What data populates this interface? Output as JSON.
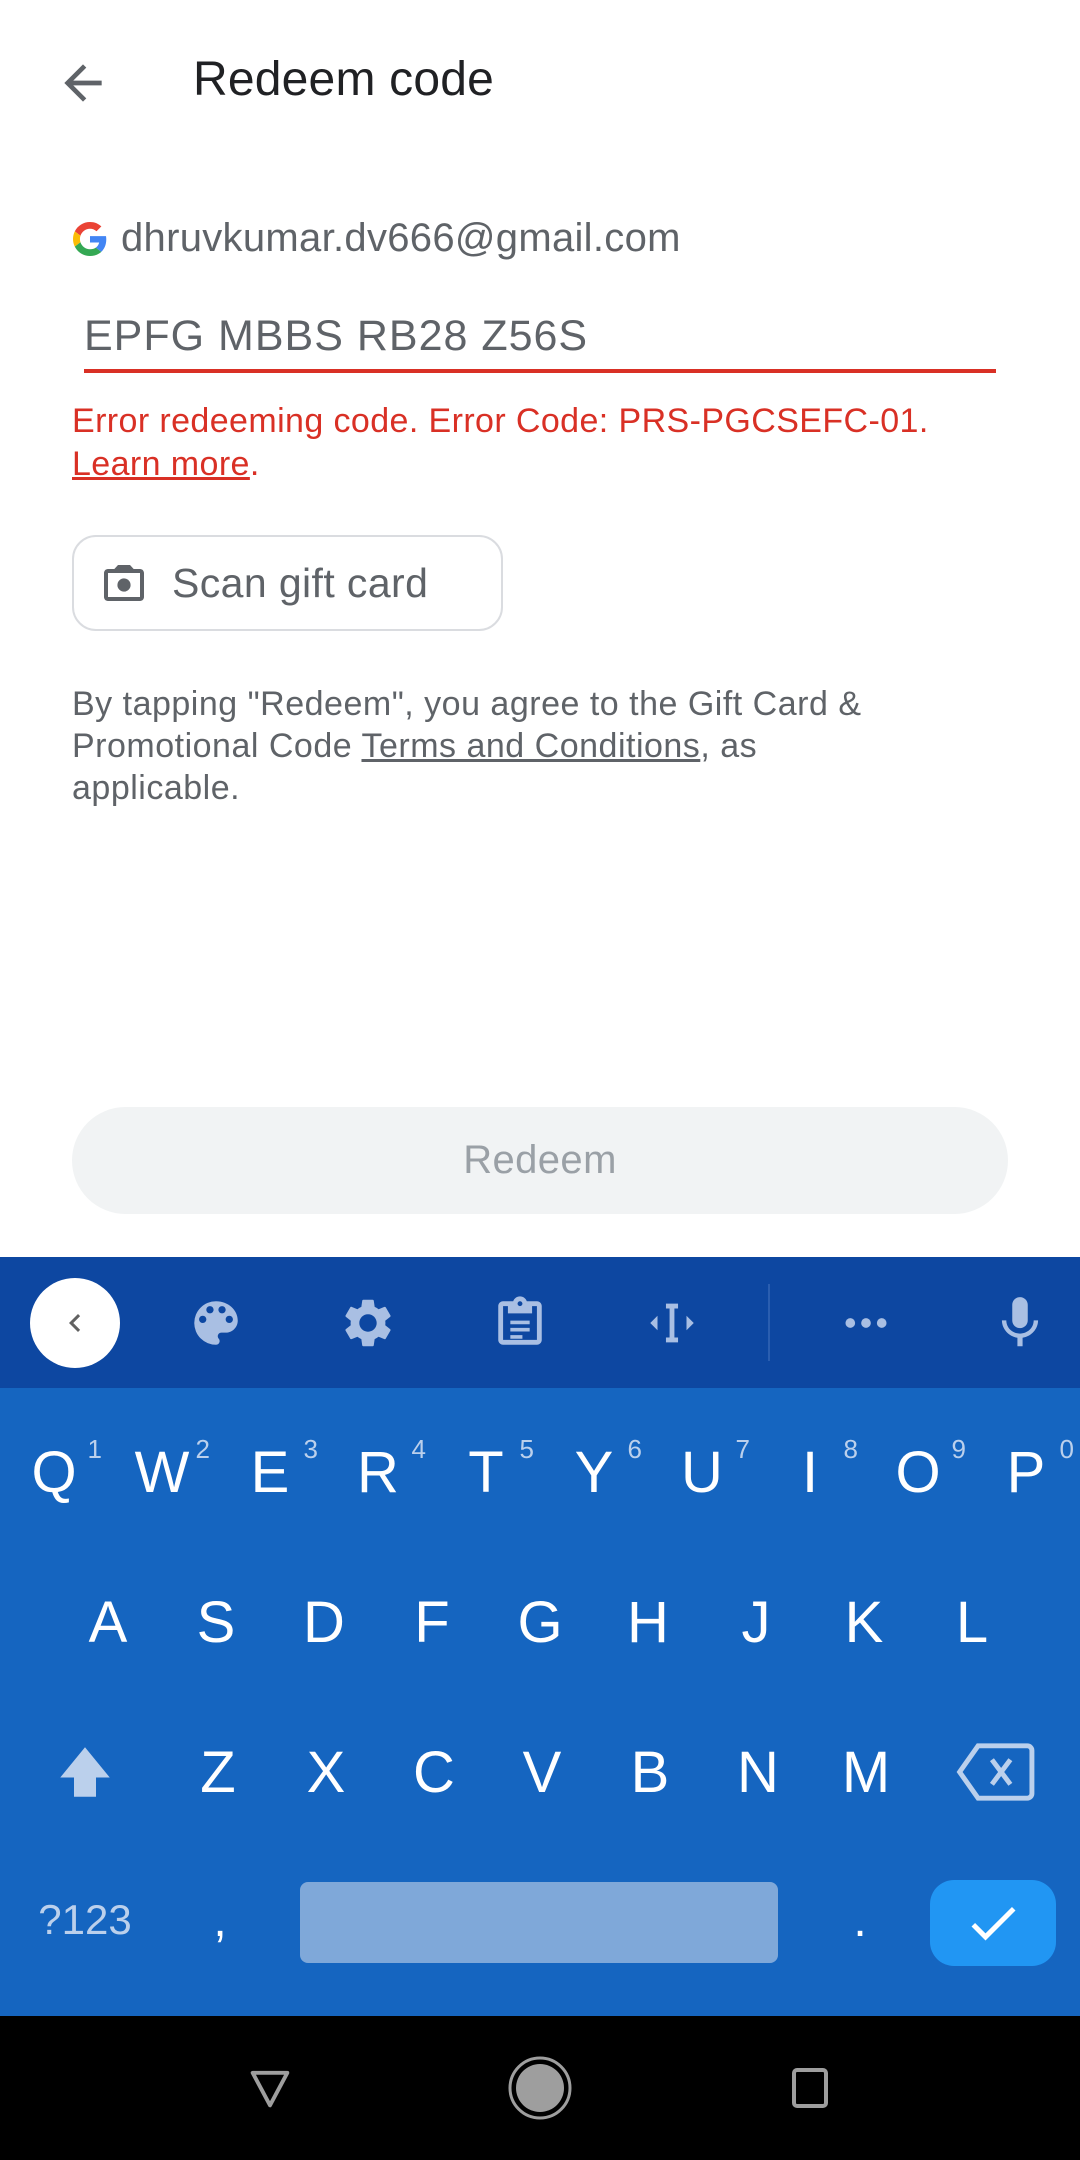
{
  "header": {
    "title": "Redeem code",
    "back_icon": "arrow-back-icon"
  },
  "account": {
    "icon": "google-g-logo",
    "email": "dhruvkumar.dv666@gmail.com"
  },
  "code_input": {
    "value": "EPFG MBBS RB28 Z56S",
    "state": "error"
  },
  "error": {
    "message": "Error redeeming code. Error Code: PRS-PGCSEFC-01.",
    "link_label": "Learn more",
    "trailing": "."
  },
  "scan_button": {
    "icon": "camera-icon",
    "label": "Scan gift card"
  },
  "terms": {
    "prefix": "By tapping \"Redeem\", you agree to the Gift Card & Promotional Code ",
    "link_label": "Terms and Conditions",
    "suffix": ", as applicable."
  },
  "redeem_button": {
    "label": "Redeem",
    "enabled": false
  },
  "keyboard": {
    "toolbar": [
      {
        "name": "collapse",
        "icon": "chevron-left-icon"
      },
      {
        "name": "theme",
        "icon": "palette-icon"
      },
      {
        "name": "settings",
        "icon": "gear-icon"
      },
      {
        "name": "clipboard",
        "icon": "clipboard-icon"
      },
      {
        "name": "text-editing",
        "icon": "cursor-move-icon"
      },
      {
        "name": "more",
        "icon": "more-horizontal-icon"
      },
      {
        "name": "voice",
        "icon": "microphone-icon"
      }
    ],
    "row1": [
      {
        "key": "Q",
        "hint": "1"
      },
      {
        "key": "W",
        "hint": "2"
      },
      {
        "key": "E",
        "hint": "3"
      },
      {
        "key": "R",
        "hint": "4"
      },
      {
        "key": "T",
        "hint": "5"
      },
      {
        "key": "Y",
        "hint": "6"
      },
      {
        "key": "U",
        "hint": "7"
      },
      {
        "key": "I",
        "hint": "8"
      },
      {
        "key": "O",
        "hint": "9"
      },
      {
        "key": "P",
        "hint": "0"
      }
    ],
    "row2": [
      "A",
      "S",
      "D",
      "F",
      "G",
      "H",
      "J",
      "K",
      "L"
    ],
    "row3": [
      "Z",
      "X",
      "C",
      "V",
      "B",
      "N",
      "M"
    ],
    "symbols_label": "?123",
    "comma": ",",
    "period": ".",
    "shift_icon": "shift-icon",
    "backspace_icon": "backspace-icon",
    "enter_icon": "check-icon",
    "colors": {
      "toolbar_bg": "#0d47a1",
      "keys_bg": "#1565c0",
      "enter_bg": "#2196f3",
      "space_bg": "#7fa8d9"
    }
  },
  "navbar": {
    "back": "nav-back-icon",
    "home": "nav-home-icon",
    "recents": "nav-recents-icon"
  },
  "colors": {
    "error": "#d93025",
    "text_primary": "#202124",
    "text_secondary": "#5f6368",
    "disabled_text": "#9aa0a6",
    "disabled_bg": "#f1f3f4"
  }
}
